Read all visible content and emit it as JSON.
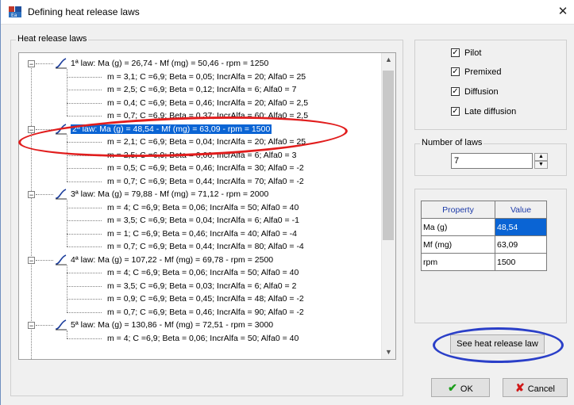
{
  "window": {
    "title": "Defining heat release laws",
    "close_glyph": "✕"
  },
  "tree": {
    "legend": "Heat release laws",
    "rows": [
      {
        "type": "law",
        "text": "1ª law: Ma (g)  = 26,74 - Mf (mg)  = 50,46 - rpm = 1250"
      },
      {
        "type": "sub",
        "text": "m = 3,1; C =6,9; Beta = 0,05; IncrAlfa = 20; Alfa0 = 25"
      },
      {
        "type": "sub",
        "text": "m = 2,5; C =6,9; Beta = 0,12; IncrAlfa = 6; Alfa0 = 7"
      },
      {
        "type": "sub",
        "text": "m = 0,4; C =6,9; Beta = 0,46; IncrAlfa = 20; Alfa0 = 2,5"
      },
      {
        "type": "sub",
        "text": "m = 0,7; C =6,9; Beta = 0,37; IncrAlfa = 60; Alfa0 = 2,5"
      },
      {
        "type": "law",
        "selected": true,
        "text": "2ª law: Ma (g)  = 48,54 - Mf (mg)  = 63,09 - rpm = 1500"
      },
      {
        "type": "sub",
        "text": "m = 2,1; C =6,9; Beta = 0,04; IncrAlfa = 20; Alfa0 = 25"
      },
      {
        "type": "sub",
        "text": "m = 2,5; C =6,9; Beta = 0,06; IncrAlfa = 6; Alfa0 = 3"
      },
      {
        "type": "sub",
        "text": "m = 0,5; C =6,9; Beta = 0,46; IncrAlfa = 30; Alfa0 = -2"
      },
      {
        "type": "sub",
        "text": "m = 0,7; C =6,9; Beta = 0,44; IncrAlfa = 70; Alfa0 = -2"
      },
      {
        "type": "law",
        "text": "3ª law: Ma (g)  = 79,88 - Mf (mg)  = 71,12 - rpm = 2000"
      },
      {
        "type": "sub",
        "text": "m = 4; C =6,9; Beta = 0,06; IncrAlfa = 50; Alfa0 = 40"
      },
      {
        "type": "sub",
        "text": "m = 3,5; C =6,9; Beta = 0,04; IncrAlfa = 6; Alfa0 = -1"
      },
      {
        "type": "sub",
        "text": "m = 1; C =6,9; Beta = 0,46; IncrAlfa = 40; Alfa0 = -4"
      },
      {
        "type": "sub",
        "text": "m = 0,7; C =6,9; Beta = 0,44; IncrAlfa = 80; Alfa0 = -4"
      },
      {
        "type": "law",
        "text": "4ª law: Ma (g)  = 107,22 - Mf (mg)  = 69,78 - rpm = 2500"
      },
      {
        "type": "sub",
        "text": "m = 4; C =6,9; Beta = 0,06; IncrAlfa = 50; Alfa0 = 40"
      },
      {
        "type": "sub",
        "text": "m = 3,5; C =6,9; Beta = 0,03; IncrAlfa = 6; Alfa0 = 2"
      },
      {
        "type": "sub",
        "text": "m = 0,9; C =6,9; Beta = 0,45; IncrAlfa = 48; Alfa0 = -2"
      },
      {
        "type": "sub",
        "text": "m = 0,7; C =6,9; Beta = 0,46; IncrAlfa = 90; Alfa0 = -2"
      },
      {
        "type": "law",
        "text": "5ª law: Ma (g)  = 130,86 - Mf (mg)  = 72,51 - rpm = 3000"
      },
      {
        "type": "sub",
        "text": "m = 4; C =6,9; Beta = 0,06; IncrAlfa = 50; Alfa0 = 40"
      }
    ]
  },
  "combustion_modes": [
    {
      "label": "Pilot",
      "checked": true
    },
    {
      "label": "Premixed",
      "checked": true
    },
    {
      "label": "Diffusion",
      "checked": true
    },
    {
      "label": "Late diffusion",
      "checked": true
    }
  ],
  "number_of_laws": {
    "legend": "Number of laws",
    "value": "7"
  },
  "properties": {
    "header_property": "Property",
    "header_value": "Value",
    "rows": [
      {
        "property": "Ma (g)",
        "value": "48,54",
        "selected": true
      },
      {
        "property": "Mf (mg)",
        "value": "63,09"
      },
      {
        "property": "rpm",
        "value": "1500"
      }
    ]
  },
  "buttons": {
    "see_law": "See heat release law",
    "ok": "OK",
    "cancel": "Cancel"
  },
  "colors": {
    "selection": "#0a64d4",
    "annotation_red": "#e11d1d",
    "annotation_blue": "#2a3fc8",
    "header_text": "#1c3aa8"
  }
}
